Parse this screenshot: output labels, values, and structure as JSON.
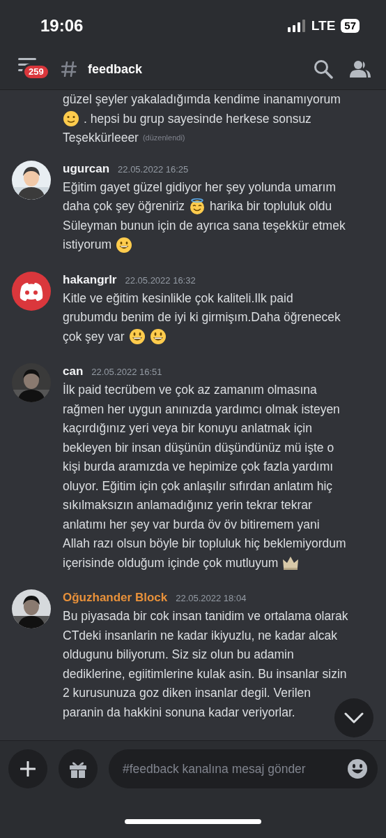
{
  "status_bar": {
    "time": "19:06",
    "network": "LTE",
    "battery": "57"
  },
  "header": {
    "unread_count": "259",
    "channel": "feedback"
  },
  "messages": [
    {
      "lines": [
        [
          {
            "kind": "text",
            "text": "güzel şeyler yakaladığımda kendime inanamıyorum"
          }
        ],
        [
          {
            "kind": "slight-smile"
          },
          {
            "kind": "text",
            "text": ". hepsi bu grup sayesinde herkese sonsuz"
          }
        ],
        [
          {
            "kind": "text",
            "text": "Teşekkürleeer"
          }
        ]
      ],
      "edited": "(düzenlendi)"
    },
    {
      "author": "ugurcan",
      "color": "#f2f3f5",
      "avatar": {
        "kind": "picture"
      },
      "time": "22.05.2022 16:25",
      "lines": [
        [
          {
            "kind": "text",
            "text": "Eğitim gayet güzel gidiyor her şey yolunda umarım"
          }
        ],
        [
          {
            "kind": "text",
            "text": "daha çok şey öğreniriz"
          },
          {
            "kind": "halo"
          },
          {
            "kind": "text",
            "text": "harika bir topluluk oldu"
          }
        ],
        [
          {
            "kind": "text",
            "text": "Süleyman bunun için de ayrıca sana teşekkür etmek"
          }
        ],
        [
          {
            "kind": "text",
            "text": "istiyorum"
          },
          {
            "kind": "grin"
          }
        ]
      ]
    },
    {
      "author": "hakangrlr",
      "color": "#f2f3f5",
      "avatar": {
        "kind": "default"
      },
      "time": "22.05.2022 16:32",
      "lines": [
        [
          {
            "kind": "text",
            "text": "Kitle ve eğitim kesinlikle çok kaliteli.Ilk paid"
          }
        ],
        [
          {
            "kind": "text",
            "text": "grubumdu benim de iyi ki girmişım.Daha öğrenecek"
          }
        ],
        [
          {
            "kind": "text",
            "text": "çok şey var"
          },
          {
            "kind": "smiley"
          },
          {
            "kind": "smiley"
          }
        ]
      ]
    },
    {
      "author": "can",
      "color": "#f2f3f5",
      "avatar": {
        "kind": "picture"
      },
      "time": "22.05.2022 16:51",
      "lines": [
        [
          {
            "kind": "text",
            "text": "İlk paid tecrübem ve çok az zamanım olmasına"
          }
        ],
        [
          {
            "kind": "text",
            "text": "rağmen her uygun anınızda yardımcı olmak isteyen"
          }
        ],
        [
          {
            "kind": "text",
            "text": "kaçırdığınız yeri veya bir konuyu anlatmak için"
          }
        ],
        [
          {
            "kind": "text",
            "text": "bekleyen bir insan düşünün düşündünüz mü işte o"
          }
        ],
        [
          {
            "kind": "text",
            "text": "kişi burda aramızda ve hepimize çok fazla yardımı"
          }
        ],
        [
          {
            "kind": "text",
            "text": "oluyor. Eğitim için çok anlaşılır sıfırdan anlatım hiç"
          }
        ],
        [
          {
            "kind": "text",
            "text": "sıkılmaksızın anlamadığınız yerin tekrar tekrar"
          }
        ],
        [
          {
            "kind": "text",
            "text": "anlatımı her şey var burda öv öv bitiremem yani"
          }
        ],
        [
          {
            "kind": "text",
            "text": "Allah razı olsun böyle bir topluluk hiç beklemiyordum"
          }
        ],
        [
          {
            "kind": "text",
            "text": "içerisinde olduğum içinde çok mutluyum"
          },
          {
            "kind": "crown"
          }
        ]
      ]
    },
    {
      "author": "Oğuzhander Block",
      "color": "#e8913a",
      "avatar": {
        "kind": "picture"
      },
      "time": "22.05.2022 18:04",
      "lines": [
        [
          {
            "kind": "text",
            "text": "Bu piyasada bir cok insan tanidim ve ortalama olarak"
          }
        ],
        [
          {
            "kind": "text",
            "text": "CTdeki insanlarin ne kadar ikiyuzlu, ne kadar alcak"
          }
        ],
        [
          {
            "kind": "text",
            "text": "oldugunu biliyorum. Siz siz olun bu adamin"
          }
        ],
        [
          {
            "kind": "text",
            "text": "dediklerine, egiitimlerine kulak asin. Bu insanlar sizin"
          }
        ],
        [
          {
            "kind": "text",
            "text": "2 kurusunuza goz diken insanlar degil. Verilen"
          }
        ],
        [
          {
            "kind": "text",
            "text": "paranin da hakkini sonuna kadar veriyorlar."
          }
        ]
      ]
    }
  ],
  "composer": {
    "placeholder": "#feedback kanalına mesaj gönder"
  }
}
